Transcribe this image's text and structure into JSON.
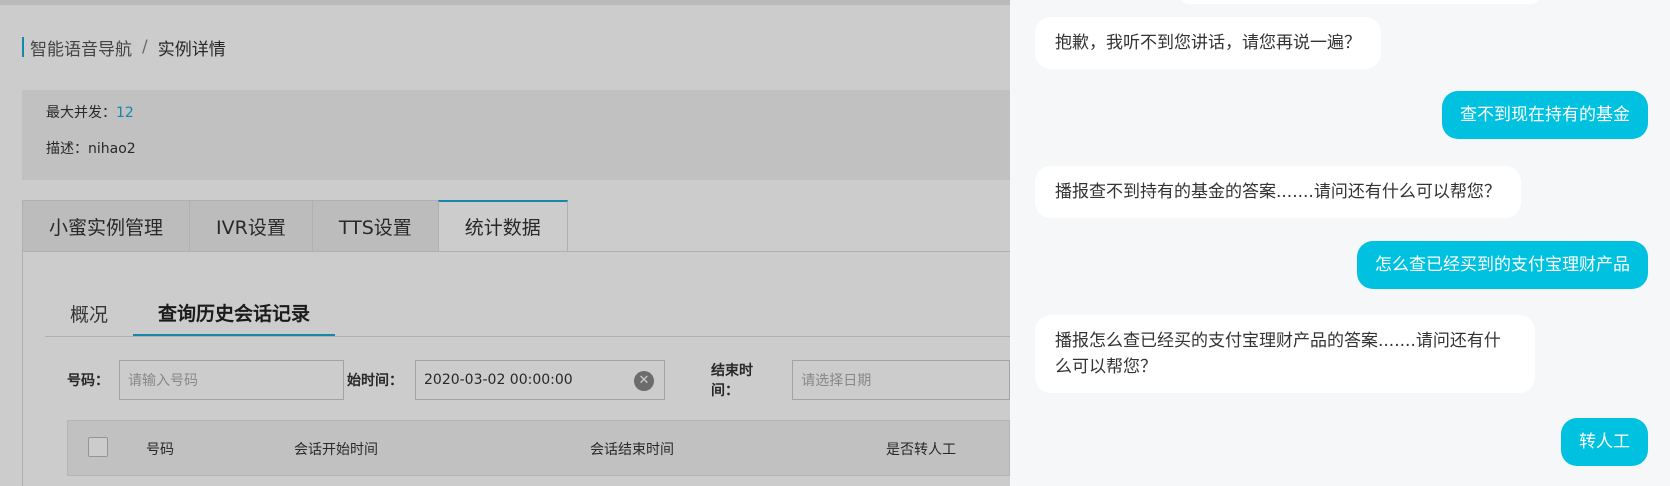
{
  "breadcrumb": {
    "parent": "智能语音导航",
    "separator": "/",
    "current": "实例详情"
  },
  "info": {
    "max_concurrency_label": "最大并发：",
    "max_concurrency_value": "12",
    "description_label": "描述：",
    "description_value": "nihao2"
  },
  "tabs": [
    "小蜜实例管理",
    "IVR设置",
    "TTS设置",
    "统计数据"
  ],
  "active_tab": "统计数据",
  "subtabs": [
    "概况",
    "查询历史会话记录"
  ],
  "active_subtab": "查询历史会话记录",
  "filters": {
    "phone_label": "号码：",
    "phone_placeholder": "请输入号码",
    "start_label": "始时间：",
    "start_value": "2020-03-02 00:00:00",
    "end_label": "结束时间：",
    "end_placeholder": "请选择日期"
  },
  "table": {
    "columns": [
      "号码",
      "会话开始时间",
      "会话结束时间",
      "是否转人工"
    ]
  },
  "chat": {
    "messages": [
      {
        "role": "bot",
        "text": "抱歉，我听不到您讲话，请您再说一遍？"
      },
      {
        "role": "user",
        "text": "查不到现在持有的基金"
      },
      {
        "role": "bot",
        "text": "播报查不到持有的基金的答案.......请问还有什么可以帮您？"
      },
      {
        "role": "user",
        "text": "怎么查已经买到的支付宝理财产品"
      },
      {
        "role": "bot",
        "text": "播报怎么查已经买的支付宝理财产品的答案.......请问还有什么可以帮您？"
      },
      {
        "role": "user",
        "text": "转人工"
      }
    ]
  },
  "colors": {
    "accent": "#1aa9d6",
    "user_bubble": "#00c2e0",
    "drawer_bg": "#f6f7f9"
  }
}
